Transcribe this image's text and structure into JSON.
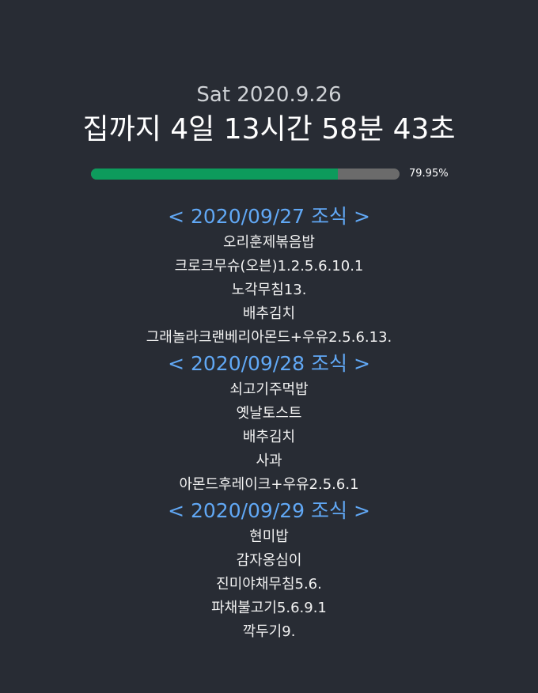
{
  "date_line": "Sat 2020.9.26",
  "countdown": "집까지 4일 13시간 58분 43초",
  "progress": {
    "percent_value": 79.95,
    "label": "79.95%",
    "fill_color": "#0d9b5c",
    "track_color": "#6b6b6b"
  },
  "meals": [
    {
      "header": "< 2020/09/27 조식 >",
      "items": [
        "오리훈제볶음밥",
        "크로크무슈(오븐)1.2.5.6.10.1",
        "노각무침13.",
        "배추김치",
        "그래놀라크랜베리아몬드+우유2.5.6.13."
      ]
    },
    {
      "header": "< 2020/09/28 조식 >",
      "items": [
        "쇠고기주먹밥",
        "옛날토스트",
        "배추김치",
        "사과",
        "아몬드후레이크+우유2.5.6.1"
      ]
    },
    {
      "header": "< 2020/09/29 조식 >",
      "items": [
        "현미밥",
        "감자옹심이",
        "진미야채무침5.6.",
        "파채불고기5.6.9.1",
        "깍두기9."
      ]
    }
  ],
  "colors": {
    "background": "#282c34",
    "header_accent": "#61a8f5"
  }
}
